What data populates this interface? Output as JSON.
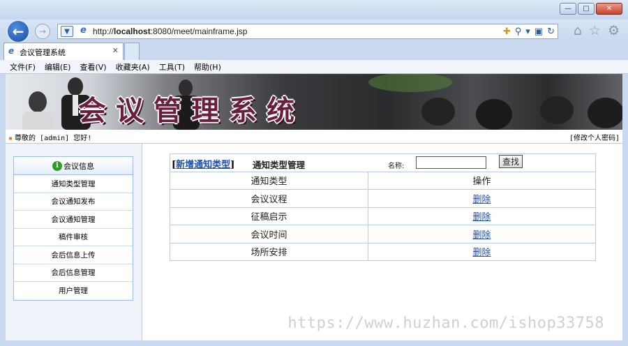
{
  "browser": {
    "url_prefix": "http://",
    "url_host": "localhost",
    "url_rest": ":8080/meet/mainframe.jsp",
    "tab_title": "会议管理系统",
    "menu": [
      "文件(F)",
      "编辑(E)",
      "查看(V)",
      "收藏夹(A)",
      "工具(T)",
      "帮助(H)"
    ],
    "icons": [
      "back-icon",
      "forward-icon",
      "compat-icon",
      "ie-icon",
      "search-icon",
      "refresh-icon",
      "home-icon",
      "star-icon",
      "gear-icon"
    ]
  },
  "banner": {
    "title": "会议管理系统"
  },
  "userbar": {
    "greeting": "尊敬的 [admin] 您好!",
    "change_password": "[修改个人密码]"
  },
  "sidebar": {
    "header": "会议信息",
    "items": [
      {
        "label": "通知类型管理"
      },
      {
        "label": "会议通知发布"
      },
      {
        "label": "会议通知管理"
      },
      {
        "label": "稿件审核"
      },
      {
        "label": "会后信息上传"
      },
      {
        "label": "会后信息管理"
      },
      {
        "label": "用户管理"
      }
    ]
  },
  "main": {
    "add_link": "新增通知类型",
    "title": "通知类型管理",
    "search_label": "名称:",
    "search_value": "",
    "search_button": "查找",
    "columns": [
      "通知类型",
      "操作"
    ],
    "rows": [
      {
        "type": "会议议程",
        "action": "删除"
      },
      {
        "type": "征稿启示",
        "action": "删除"
      },
      {
        "type": "会议时间",
        "action": "删除"
      },
      {
        "type": "场所安排",
        "action": "删除"
      }
    ]
  },
  "watermark": "https://www.huzhan.com/ishop33758"
}
